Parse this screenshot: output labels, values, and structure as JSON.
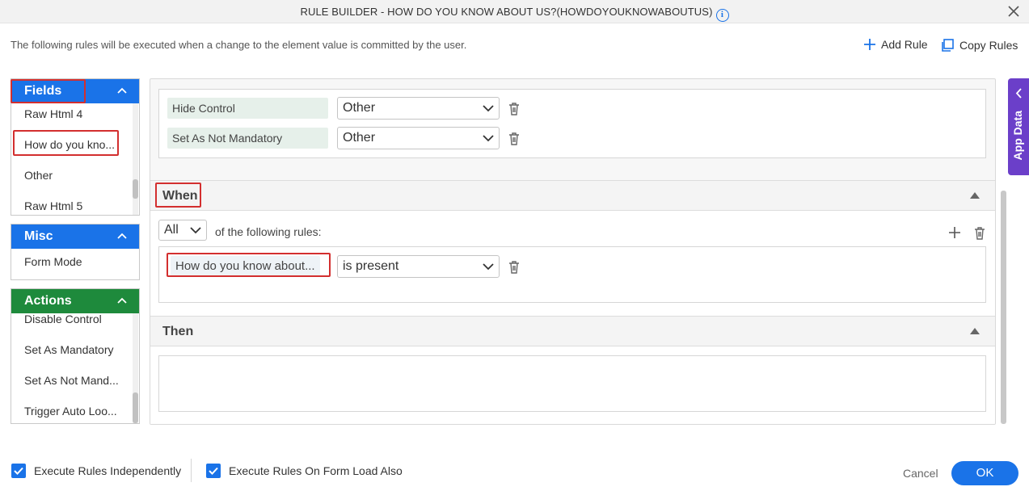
{
  "title": "RULE BUILDER - HOW DO YOU KNOW ABOUT US?(HOWDOYOUKNOWABOUTUS)",
  "subtitle": "The following rules will be executed when a change to the element value is committed by the user.",
  "toolbar": {
    "add_rule": "Add Rule",
    "copy_rules": "Copy Rules"
  },
  "colors": {
    "accent": "#1a73e8",
    "fields_header": "#1a73e8",
    "misc_header": "#1a73e8",
    "actions_header": "#1e8a3c",
    "app_data": "#6b3fc9",
    "highlight": "#d32f2f"
  },
  "left_panel": {
    "fields": {
      "label": "Fields",
      "items": [
        "Raw Html 4",
        "How do you kno...",
        "Other",
        "Raw Html 5"
      ]
    },
    "misc": {
      "label": "Misc",
      "items": [
        "Form Mode"
      ]
    },
    "actions": {
      "label": "Actions",
      "items": [
        "Disable Control",
        "Set As Mandatory",
        "Set As Not Mand...",
        "Trigger Auto Loo..."
      ]
    }
  },
  "actions_block": {
    "rows": [
      {
        "action": "Hide Control",
        "target": "Other"
      },
      {
        "action": "Set As Not Mandatory",
        "target": "Other"
      }
    ]
  },
  "when": {
    "label": "When",
    "match_select": "All",
    "match_text": "of the following rules:",
    "condition": {
      "field": "How do you know about...",
      "operator": "is present"
    }
  },
  "then": {
    "label": "Then"
  },
  "app_data": "App Data",
  "footer": {
    "execute_independently": "Execute Rules Independently",
    "execute_on_load": "Execute Rules On Form Load Also",
    "cancel": "Cancel",
    "ok": "OK"
  }
}
